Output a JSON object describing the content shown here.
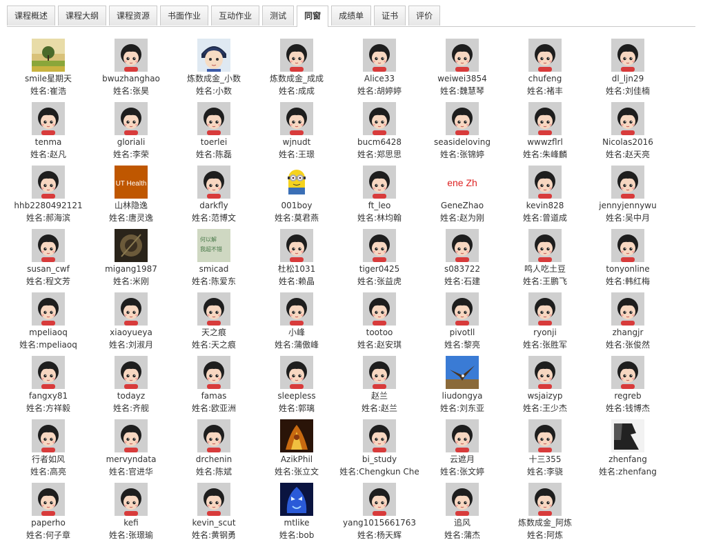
{
  "tabs": [
    {
      "label": "课程概述"
    },
    {
      "label": "课程大纲"
    },
    {
      "label": "课程资源"
    },
    {
      "label": "书面作业"
    },
    {
      "label": "互动作业"
    },
    {
      "label": "测试"
    },
    {
      "label": "同窗",
      "active": true
    },
    {
      "label": "成绩单"
    },
    {
      "label": "证书"
    },
    {
      "label": "评价"
    }
  ],
  "name_prefix": "姓名:",
  "classmates": [
    {
      "username": "smile星期天",
      "realname": "崔浩",
      "avatar": "landscape-photo"
    },
    {
      "username": "bwuzhanghao",
      "realname": "张昊",
      "avatar": "default-avatar"
    },
    {
      "username": "炼数成金_小数",
      "realname": "小数",
      "avatar": "anime-boy-avatar"
    },
    {
      "username": "炼数成金_成成",
      "realname": "成成",
      "avatar": "default-avatar"
    },
    {
      "username": "Alice33",
      "realname": "胡婷婷",
      "avatar": "default-avatar"
    },
    {
      "username": "weiwei3854",
      "realname": "魏慧琴",
      "avatar": "default-avatar"
    },
    {
      "username": "chufeng",
      "realname": "褚丰",
      "avatar": "default-avatar"
    },
    {
      "username": "dl_ljn29",
      "realname": "刘佳楠",
      "avatar": "default-avatar"
    },
    {
      "username": "tenma",
      "realname": "赵凡",
      "avatar": "default-avatar"
    },
    {
      "username": "gloriali",
      "realname": "李荣",
      "avatar": "default-avatar"
    },
    {
      "username": "toerlei",
      "realname": "陈磊",
      "avatar": "default-avatar"
    },
    {
      "username": "wjnudt",
      "realname": "王璟",
      "avatar": "default-avatar"
    },
    {
      "username": "bucm6428",
      "realname": "郑思思",
      "avatar": "default-avatar"
    },
    {
      "username": "seasideloving",
      "realname": "张锦婷",
      "avatar": "default-avatar"
    },
    {
      "username": "wwwzflrl",
      "realname": "朱峰麟",
      "avatar": "default-avatar"
    },
    {
      "username": "Nicolas2016",
      "realname": "赵天亮",
      "avatar": "default-avatar"
    },
    {
      "username": "hhb2280492121",
      "realname": "郝海滨",
      "avatar": "default-avatar"
    },
    {
      "username": "山林隐逸",
      "realname": "唐灵逸",
      "avatar": "health-logo",
      "avatar_text": "UT Health"
    },
    {
      "username": "darkfly",
      "realname": "范博文",
      "avatar": "default-avatar"
    },
    {
      "username": "001boy",
      "realname": "莫君燕",
      "avatar": "minion-avatar"
    },
    {
      "username": "ft_leo",
      "realname": "林均翰",
      "avatar": "default-avatar"
    },
    {
      "username": "GeneZhao",
      "realname": "赵为刚",
      "avatar": "text-avatar",
      "avatar_text": "ene Zh"
    },
    {
      "username": "kevin828",
      "realname": "曾道成",
      "avatar": "default-avatar"
    },
    {
      "username": "jennyjennywu",
      "realname": "吴中月",
      "avatar": "default-avatar"
    },
    {
      "username": "susan_cwf",
      "realname": "程文芳",
      "avatar": "default-avatar"
    },
    {
      "username": "migang1987",
      "realname": "米刚",
      "avatar": "dark-art-photo"
    },
    {
      "username": "smicad",
      "realname": "陈爱东",
      "avatar": "handwriting-photo",
      "avatar_text": "何以解 我超不错"
    },
    {
      "username": "杜松1031",
      "realname": "赖晶",
      "avatar": "default-avatar"
    },
    {
      "username": "tiger0425",
      "realname": "张益虎",
      "avatar": "default-avatar"
    },
    {
      "username": "s083722",
      "realname": "石建",
      "avatar": "default-avatar"
    },
    {
      "username": "鸣人吃土豆",
      "realname": "王鹏飞",
      "avatar": "default-avatar"
    },
    {
      "username": "tonyonline",
      "realname": "韩红梅",
      "avatar": "default-avatar"
    },
    {
      "username": "mpeliaoq",
      "realname": "mpeliaoq",
      "avatar": "default-avatar"
    },
    {
      "username": "xiaoyueya",
      "realname": "刘淑月",
      "avatar": "default-avatar"
    },
    {
      "username": "天之痕",
      "realname": "天之痕",
      "avatar": "default-avatar"
    },
    {
      "username": "小峰",
      "realname": "蒲傲峰",
      "avatar": "default-avatar"
    },
    {
      "username": "tootoo",
      "realname": "赵安琪",
      "avatar": "default-avatar"
    },
    {
      "username": "pivotll",
      "realname": "黎亮",
      "avatar": "default-avatar"
    },
    {
      "username": "ryonji",
      "realname": "张胜军",
      "avatar": "default-avatar"
    },
    {
      "username": "zhangjr",
      "realname": "张俊然",
      "avatar": "default-avatar"
    },
    {
      "username": "fangxy81",
      "realname": "方祥毅",
      "avatar": "default-avatar"
    },
    {
      "username": "todayz",
      "realname": "齐舰",
      "avatar": "default-avatar"
    },
    {
      "username": "famas",
      "realname": "欧亚洲",
      "avatar": "default-avatar"
    },
    {
      "username": "sleepless",
      "realname": "郭璃",
      "avatar": "default-avatar"
    },
    {
      "username": "赵兰",
      "realname": "赵兰",
      "avatar": "default-avatar"
    },
    {
      "username": "liudongya",
      "realname": "刘东亚",
      "avatar": "eagle-photo"
    },
    {
      "username": "wsjaizyp",
      "realname": "王少杰",
      "avatar": "default-avatar"
    },
    {
      "username": "regreb",
      "realname": "钱博杰",
      "avatar": "default-avatar"
    },
    {
      "username": "行者如风",
      "realname": "高亮",
      "avatar": "default-avatar"
    },
    {
      "username": "mervyndata",
      "realname": "官进华",
      "avatar": "default-avatar"
    },
    {
      "username": "drchenin",
      "realname": "陈斌",
      "avatar": "default-avatar"
    },
    {
      "username": "AzikPhil",
      "realname": "张立文",
      "avatar": "fire-art-photo"
    },
    {
      "username": "bi_study",
      "realname": "Chengkun Che",
      "avatar": "default-avatar"
    },
    {
      "username": "云遮月",
      "realname": "张文婷",
      "avatar": "default-avatar"
    },
    {
      "username": "十三355",
      "realname": "李骁",
      "avatar": "default-avatar"
    },
    {
      "username": "zhenfang",
      "realname": "zhenfang",
      "avatar": "silhouette-photo"
    },
    {
      "username": "paperho",
      "realname": "何子章",
      "avatar": "default-avatar"
    },
    {
      "username": "kefi",
      "realname": "张璟瑜",
      "avatar": "default-avatar"
    },
    {
      "username": "kevin_scut",
      "realname": "黄钢勇",
      "avatar": "default-avatar"
    },
    {
      "username": "mtlike",
      "realname": "bob",
      "avatar": "blue-monster-avatar"
    },
    {
      "username": "yang1015661763",
      "realname": "杨天辉",
      "avatar": "default-avatar"
    },
    {
      "username": "追风",
      "realname": "蒲杰",
      "avatar": "default-avatar"
    },
    {
      "username": "炼数成金_阿炼",
      "realname": "阿炼",
      "avatar": "default-avatar"
    }
  ]
}
